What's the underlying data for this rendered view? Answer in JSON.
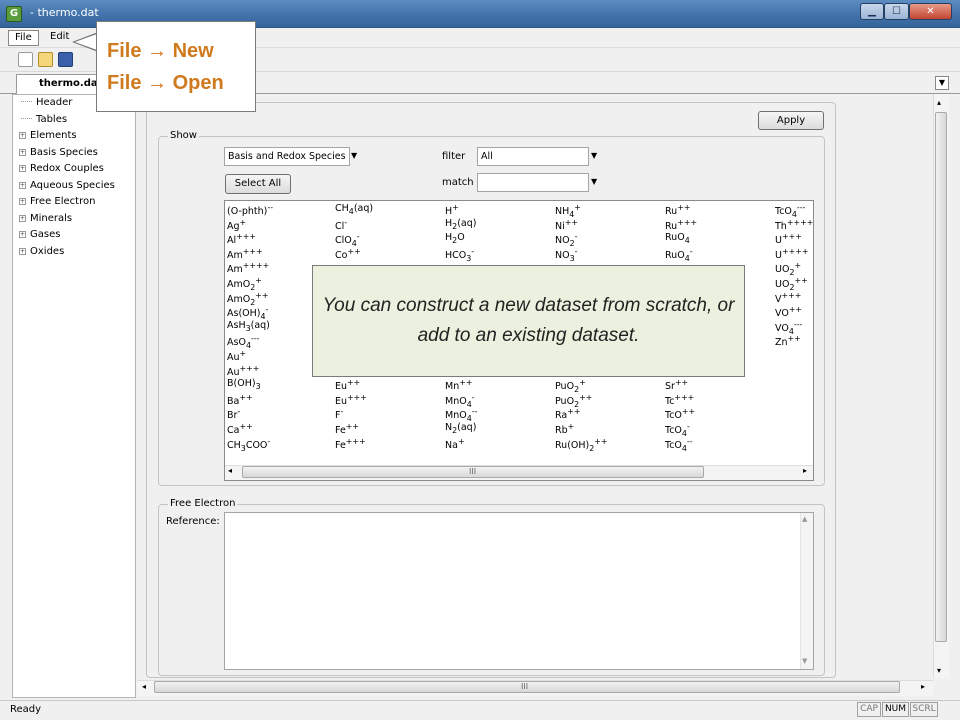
{
  "window": {
    "title": "- thermo.dat",
    "icon_letter": "G",
    "min": "▁",
    "max": "☐",
    "close": "✕"
  },
  "menu": {
    "file": "File",
    "edit": "Edit"
  },
  "tab": {
    "label": "thermo.dat",
    "dropdown": "▼"
  },
  "tree": {
    "items": [
      {
        "label": "Header",
        "expandable": false
      },
      {
        "label": "Tables",
        "expandable": false
      },
      {
        "label": "Elements",
        "expandable": true
      },
      {
        "label": "Basis Species",
        "expandable": true
      },
      {
        "label": "Redox Couples",
        "expandable": true
      },
      {
        "label": "Aqueous Species",
        "expandable": true
      },
      {
        "label": "Free Electron",
        "expandable": true
      },
      {
        "label": "Minerals",
        "expandable": true
      },
      {
        "label": "Gases",
        "expandable": true
      },
      {
        "label": "Oxides",
        "expandable": true
      }
    ],
    "expander": "+"
  },
  "main": {
    "apply_label": "Apply",
    "show_group_label": "Show",
    "show_combo_value": "Basis and Redox Species",
    "filter_label": "filter",
    "filter_value": "All",
    "select_all_label": "Select All",
    "match_label": "match",
    "match_value": "",
    "free_electron_group_label": "Free Electron",
    "reference_label": "Reference:",
    "scroll_grip": "III",
    "dropdown_arrow": "▼"
  },
  "species_columns": [
    [
      "(O-phth)<sup>--</sup>",
      "Ag<sup>+</sup>",
      "Al<sup>+++</sup>",
      "Am<sup>+++</sup>",
      "Am<sup>++++</sup>",
      "AmO<sub>2</sub><sup>+</sup>",
      "AmO<sub>2</sub><sup>++</sup>",
      "As(OH)<sub>4</sub><sup>-</sup>",
      "AsH<sub>3</sub>(aq)",
      "AsO<sub>4</sub><sup>---</sup>",
      "Au<sup>+</sup>",
      "Au<sup>+++</sup>",
      "B(OH)<sub>3</sub>",
      "Ba<sup>++</sup>",
      "Br<sup>-</sup>",
      "Ca<sup>++</sup>",
      "CH<sub>3</sub>COO<sup>-</sup>"
    ],
    [
      "CH<sub>4</sub>(aq)",
      "Cl<sup>-</sup>",
      "ClO<sub>4</sub><sup>-</sup>",
      "Co<sup>++</sup>",
      "",
      "",
      "",
      "",
      "",
      "",
      "",
      "",
      "Eu<sup>++</sup>",
      "Eu<sup>+++</sup>",
      "F<sup>-</sup>",
      "Fe<sup>++</sup>",
      "Fe<sup>+++</sup>"
    ],
    [
      "H<sup>+</sup>",
      "H<sub>2</sub>(aq)",
      "H<sub>2</sub>O",
      "HCO<sub>3</sub><sup>-</sup>",
      "",
      "",
      "",
      "",
      "",
      "",
      "",
      "",
      "Mn<sup>++</sup>",
      "MnO<sub>4</sub><sup>-</sup>",
      "MnO<sub>4</sub><sup>--</sup>",
      "N<sub>2</sub>(aq)",
      "Na<sup>+</sup>"
    ],
    [
      "NH<sub>4</sub><sup>+</sup>",
      "Ni<sup>++</sup>",
      "NO<sub>2</sub><sup>-</sup>",
      "NO<sub>3</sub><sup>-</sup>",
      "",
      "",
      "",
      "",
      "",
      "",
      "",
      "",
      "PuO<sub>2</sub><sup>+</sup>",
      "PuO<sub>2</sub><sup>++</sup>",
      "Ra<sup>++</sup>",
      "Rb<sup>+</sup>",
      "Ru(OH)<sub>2</sub><sup>++</sup>"
    ],
    [
      "Ru<sup>++</sup>",
      "Ru<sup>+++</sup>",
      "RuO<sub>4</sub>",
      "RuO<sub>4</sub><sup>-</sup>",
      "",
      "",
      "",
      "",
      "",
      "",
      "",
      "",
      "Sr<sup>++</sup>",
      "Tc<sup>+++</sup>",
      "TcO<sup>++</sup>",
      "TcO<sub>4</sub><sup>-</sup>",
      "TcO<sub>4</sub><sup>--</sup>"
    ],
    [
      "TcO<sub>4</sub><sup>---</sup>",
      "Th<sup>++++</sup>",
      "U<sup>+++</sup>",
      "U<sup>++++</sup>",
      "UO<sub>2</sub><sup>+</sup>",
      "UO<sub>2</sub><sup>++</sup>",
      "V<sup>+++</sup>",
      "VO<sup>++</sup>",
      "VO<sub>4</sub><sup>---</sup>",
      "Zn<sup>++</sup>",
      "",
      "",
      "",
      "",
      "",
      "",
      ""
    ]
  ],
  "callout": {
    "line1": "File → New",
    "line2": "File → Open"
  },
  "note": {
    "text": "You can construct a new dataset from scratch, or add to an existing dataset."
  },
  "status": {
    "text": "Ready",
    "cap": "CAP",
    "num": "NUM",
    "scrl": "SCRL"
  },
  "colors": {
    "callout_text": "#d07a1e",
    "note_bg": "#ebf1de",
    "titlebar": "#3f70a8"
  }
}
